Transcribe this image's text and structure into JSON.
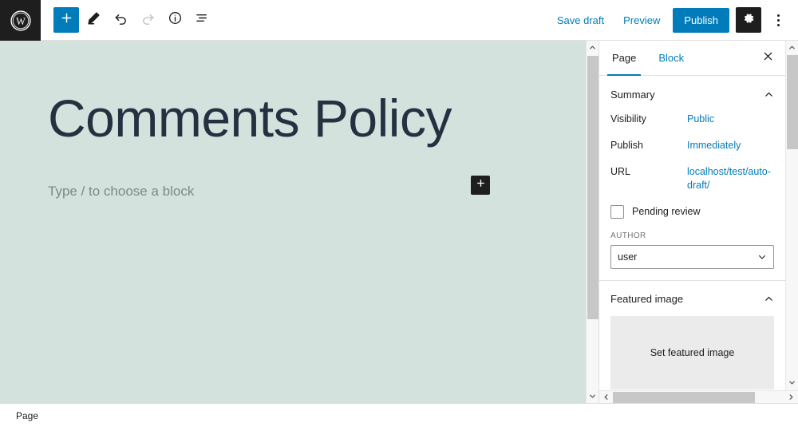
{
  "toolbar": {
    "logo_icon": "wordpress-logo-icon",
    "add_block_label": "Add block",
    "add_block_icon": "plus-icon",
    "tools_icon": "pencil-icon",
    "undo_icon": "undo-arrow-icon",
    "redo_icon": "redo-arrow-icon",
    "details_icon": "info-circle-icon",
    "list_view_icon": "list-view-icon",
    "save_draft_label": "Save draft",
    "preview_label": "Preview",
    "publish_label": "Publish",
    "settings_icon": "gear-icon",
    "options_icon": "more-vertical-icon",
    "accent_color": "#007cba",
    "dark_color": "#1e1e1e"
  },
  "editor": {
    "title": "Comments Policy",
    "paragraph_placeholder": "Type / to choose a block",
    "inserter_icon": "plus-icon",
    "canvas_background": "#d3e2dd",
    "title_color": "#253140"
  },
  "sidebar": {
    "tabs": [
      {
        "label": "Page",
        "active": true
      },
      {
        "label": "Block",
        "active": false
      }
    ],
    "close_icon": "close-icon",
    "summary": {
      "title": "Summary",
      "chevron_icon": "chevron-up-icon",
      "rows": [
        {
          "label": "Visibility",
          "value": "Public"
        },
        {
          "label": "Publish",
          "value": "Immediately"
        },
        {
          "label": "URL",
          "value": "localhost/test/auto-draft/"
        }
      ],
      "pending_review_label": "Pending review",
      "pending_review_checked": false,
      "author_label": "AUTHOR",
      "author_value": "user",
      "author_chevron_icon": "chevron-down-icon"
    },
    "featured_image": {
      "title": "Featured image",
      "chevron_icon": "chevron-up-icon",
      "set_label": "Set featured image"
    },
    "scroll_up_icon": "chevron-up-icon",
    "scroll_down_icon": "chevron-down-icon",
    "scroll_left_icon": "chevron-left-icon",
    "scroll_right_icon": "chevron-right-icon"
  },
  "canvas_scrollbar": {
    "up_icon": "chevron-up-icon",
    "down_icon": "chevron-down-icon"
  },
  "statusbar": {
    "breadcrumb": "Page"
  }
}
